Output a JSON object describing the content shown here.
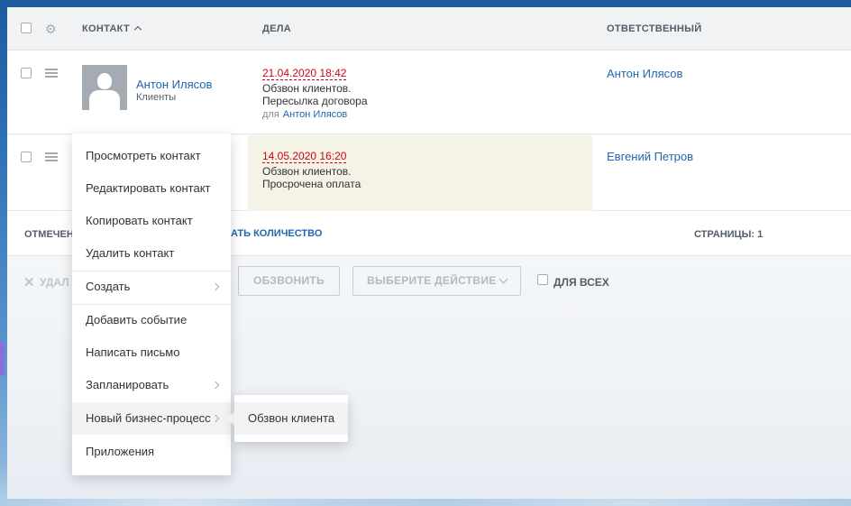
{
  "header": {
    "col_contact": "КОНТАКТ",
    "col_deals": "ДЕЛА",
    "col_responsible": "ОТВЕТСТВЕННЫЙ"
  },
  "rows": [
    {
      "contact_name": "Антон Илясов",
      "contact_type": "Клиенты",
      "deal_date": "21.04.2020 18:42",
      "deal_line1": "Обзвон клиентов.",
      "deal_line2": "Пересылка договора",
      "deal_for_label": "для",
      "deal_for_name": "Антон Илясов",
      "responsible": "Антон Илясов"
    },
    {
      "deal_date": "14.05.2020 16:20",
      "deal_line1": "Обзвон клиентов.",
      "deal_line2": "Просрочена оплата",
      "responsible": "Евгений Петров"
    }
  ],
  "footer": {
    "selected_label": "ОТМЕЧЕН",
    "count_link": "АТЬ КОЛИЧЕСТВО",
    "pages_label": "СТРАНИЦЫ:",
    "pages_value": "1"
  },
  "actions": {
    "delete_label": "УДАЛ",
    "call_button": "ОБЗВОНИТЬ",
    "action_select": "ВЫБЕРИТЕ ДЕЙСТВИЕ",
    "for_all_label": "ДЛЯ ВСЕХ"
  },
  "context_menu": {
    "items": [
      "Просмотреть контакт",
      "Редактировать контакт",
      "Копировать контакт",
      "Удалить контакт",
      "Создать",
      "Добавить событие",
      "Написать письмо",
      "Запланировать",
      "Новый бизнес-процесс",
      "Приложения"
    ]
  },
  "submenu": {
    "items": [
      "Обзвон клиента"
    ]
  },
  "colors": {
    "link": "#2067b0",
    "overdue": "#d0021b",
    "highlight_cell": "#f5f2e6"
  }
}
